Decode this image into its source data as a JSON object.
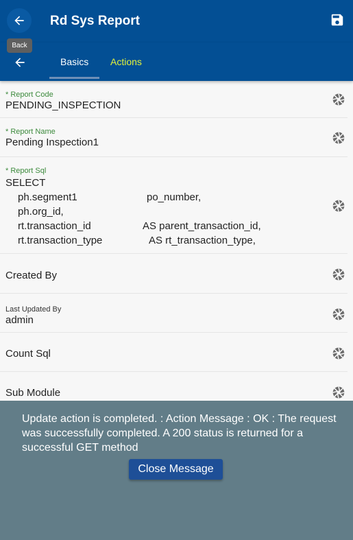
{
  "header": {
    "title": "Rd Sys Report",
    "back_tooltip": "Back",
    "back_icon": "arrow-left-icon",
    "save_icon": "floppy-save-icon"
  },
  "tabs": [
    {
      "label": "Basics",
      "active": true
    },
    {
      "label": "Actions",
      "active": false
    }
  ],
  "colors": {
    "primary": "#034f94",
    "active_tab_accent": "#e3f23a",
    "required_label": "#3c8a3c",
    "overlay": "#627d88",
    "button": "#1e4f97"
  },
  "fields": {
    "report_code": {
      "label": "* Report Code",
      "value": "PENDING_INSPECTION"
    },
    "report_name": {
      "label": "* Report Name",
      "value": "Pending Inspection1"
    },
    "report_sql": {
      "label": "* Report Sql",
      "lines": [
        [
          "SELECT",
          ""
        ],
        [
          "ph.segment1",
          "po_number,"
        ],
        [
          "ph.org_id,",
          ""
        ],
        [
          "rt.transaction_id",
          "AS parent_transaction_id,"
        ],
        [
          "rt.transaction_type",
          "AS rt_transaction_type,"
        ]
      ]
    },
    "created_by": {
      "label": "Created By"
    },
    "last_updated_by": {
      "label": "Last Updated By",
      "value": "admin"
    },
    "count_sql": {
      "label": "Count Sql"
    },
    "sub_module": {
      "label": "Sub Module"
    }
  },
  "row_action_icon": "aperture-icon",
  "message": {
    "text": "Update action is completed.  : Action Message : OK : The request was successfully completed. A 200 status is returned for a successful GET method",
    "close_label": "Close Message"
  }
}
